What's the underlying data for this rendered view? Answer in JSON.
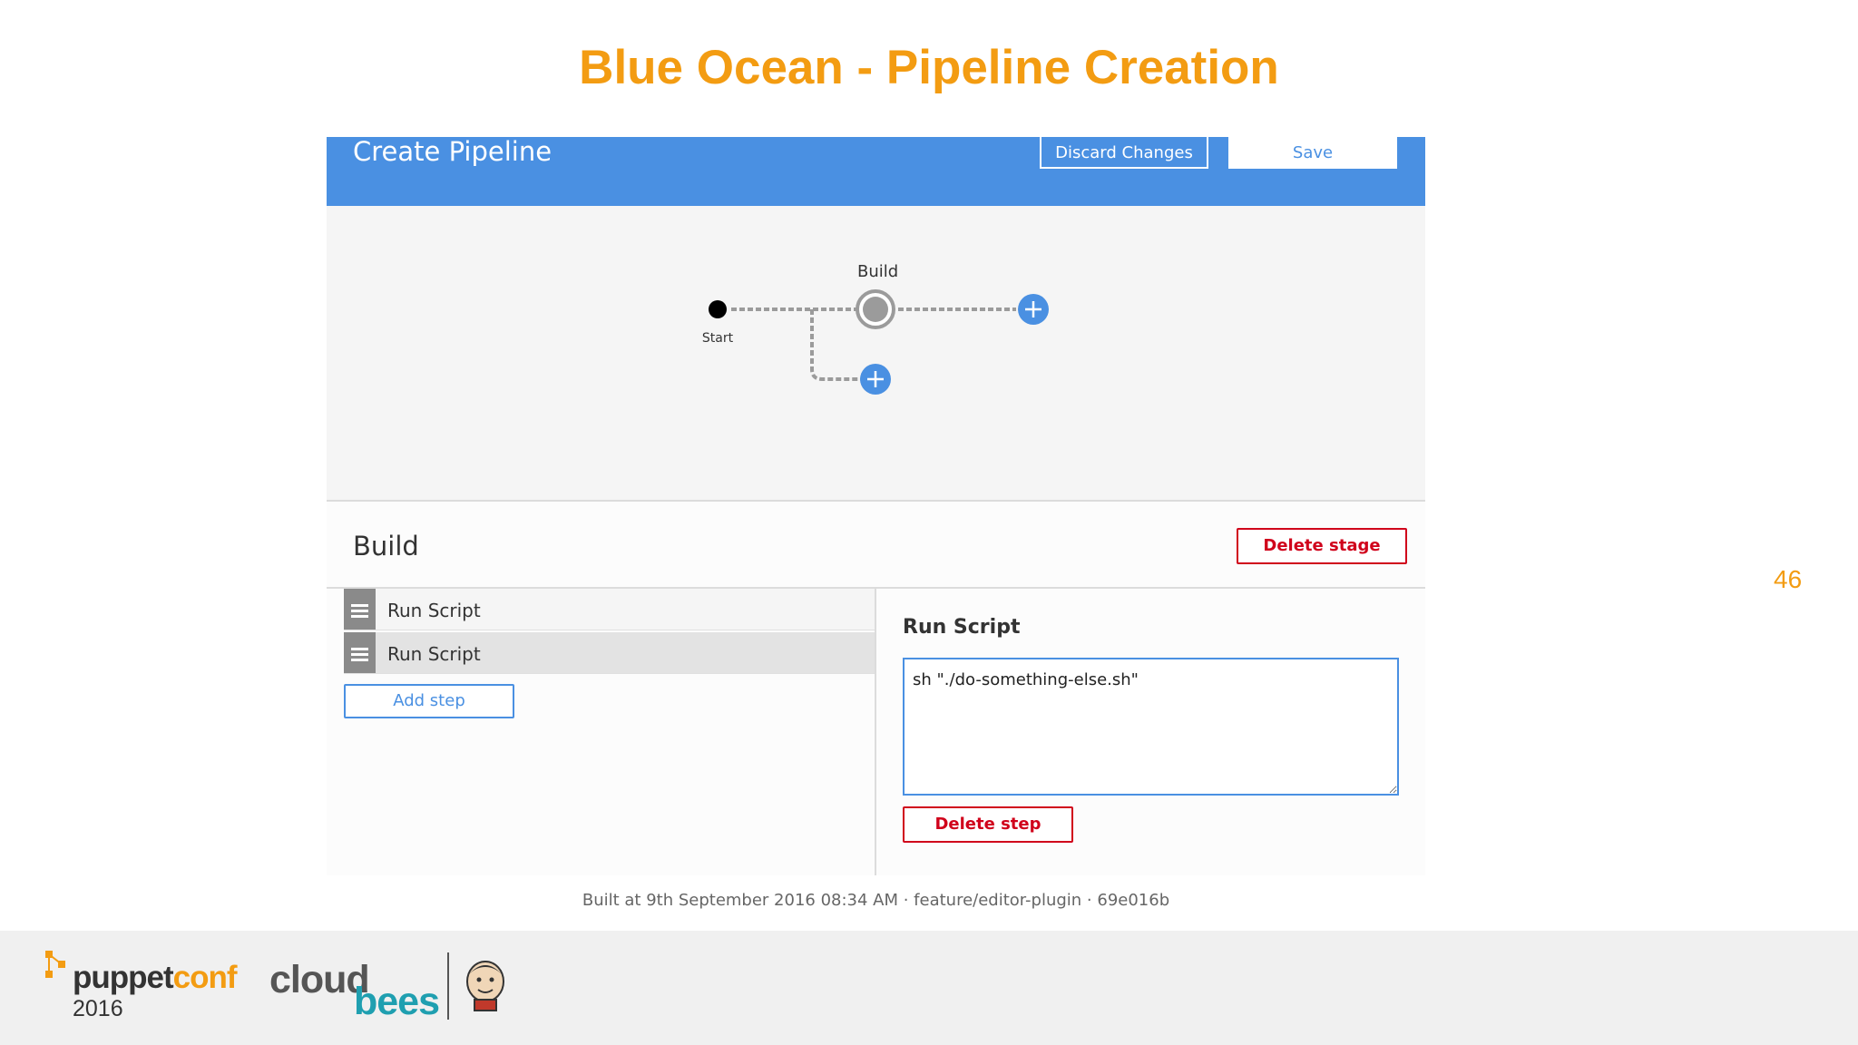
{
  "slide": {
    "title": "Blue Ocean - Pipeline Creation",
    "number": "46"
  },
  "header": {
    "title": "Create Pipeline",
    "discard_label": "Discard Changes",
    "save_label": "Save"
  },
  "graph": {
    "stage_label": "Build",
    "start_label": "Start"
  },
  "stage": {
    "title": "Build",
    "delete_stage_label": "Delete stage"
  },
  "steps": [
    {
      "label": "Run Script",
      "selected": false
    },
    {
      "label": "Run Script",
      "selected": true
    }
  ],
  "add_step_label": "Add step",
  "editor": {
    "title": "Run Script",
    "script": "sh \"./do-something-else.sh\"",
    "delete_step_label": "Delete step"
  },
  "footer": {
    "build_info": "Built at 9th September 2016 08:34 AM · feature/editor-plugin · 69e016b"
  },
  "branding": {
    "puppet": "puppet",
    "conf": "conf",
    "year": "2016",
    "cloud": "cloud",
    "bees": "bees"
  },
  "colors": {
    "accent_blue": "#4a90e2",
    "danger_red": "#d0021b",
    "slide_orange": "#f39c12"
  }
}
